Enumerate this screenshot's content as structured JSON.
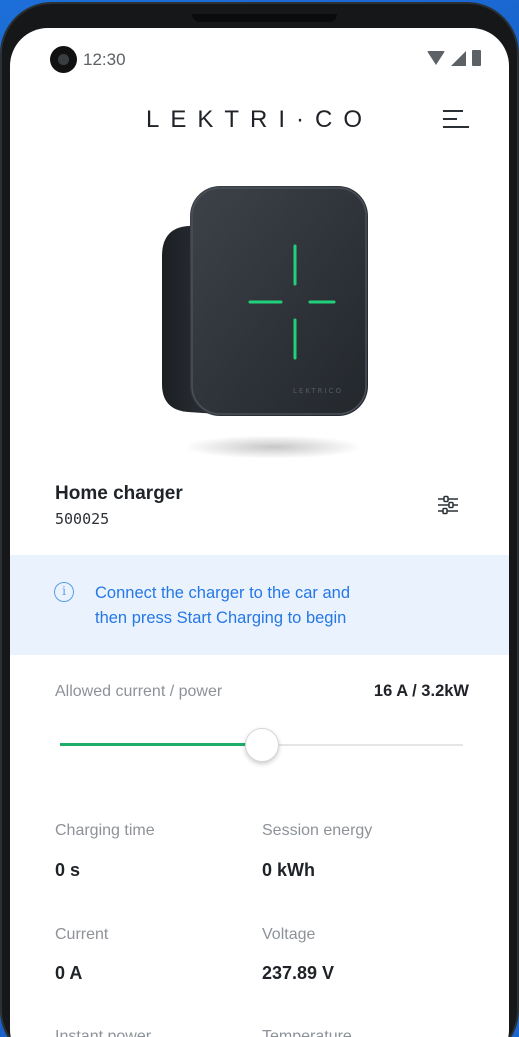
{
  "status_bar": {
    "time": "12:30"
  },
  "header": {
    "brand": "LEKTRI·CO"
  },
  "charger": {
    "name": "Home charger",
    "serial": "500025"
  },
  "info_banner": {
    "text_line1": "Connect the charger to the car and",
    "text_line2": "then press Start Charging to begin",
    "icon": "i"
  },
  "current_control": {
    "label": "Allowed current / power",
    "value": "16 A / 3.2kW",
    "slider_fraction": 0.5
  },
  "stats": {
    "charging_time": {
      "label": "Charging time",
      "value": "0 s"
    },
    "session_energy": {
      "label": "Session energy",
      "value": "0 kWh"
    },
    "current": {
      "label": "Current",
      "value": "0 A"
    },
    "voltage": {
      "label": "Voltage",
      "value": "237.89 V"
    },
    "instant_power": {
      "label": "Instant power"
    },
    "temperature": {
      "label": "Temperature"
    }
  },
  "colors": {
    "accent_green": "#1fae6a",
    "info_blue": "#2577e6",
    "background_blue": "#1b66cf"
  },
  "icons": {
    "menu": "menu-icon",
    "settings": "sliders-icon",
    "info": "info-icon"
  }
}
